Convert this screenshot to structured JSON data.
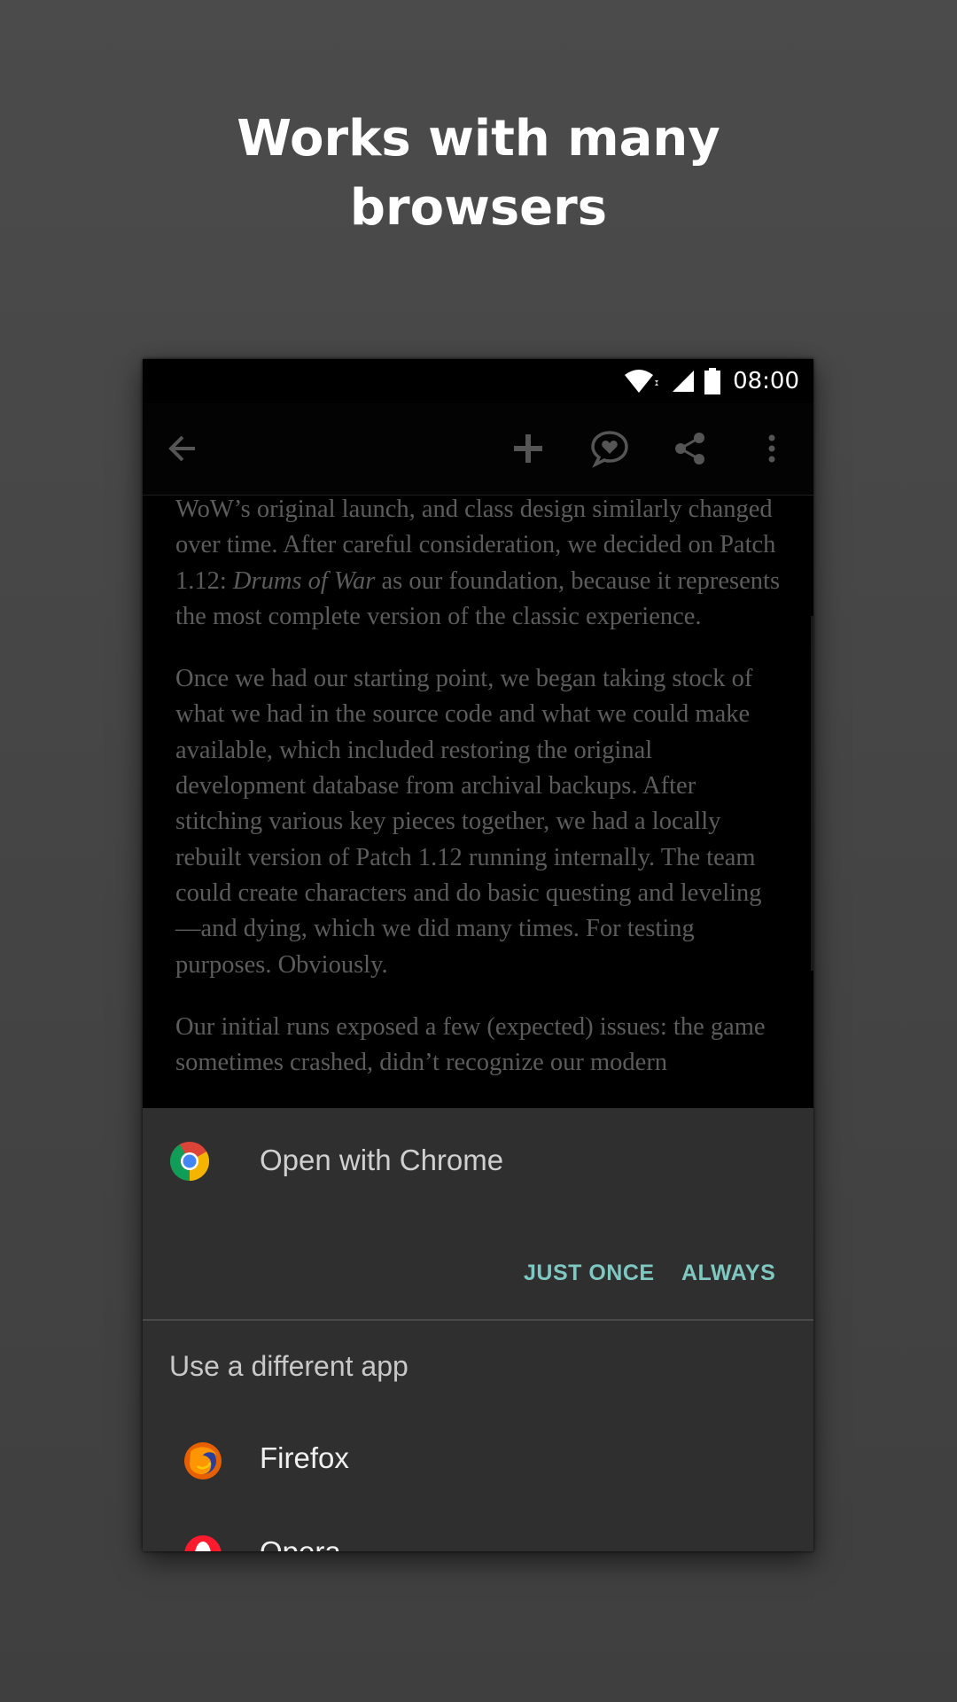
{
  "headline": [
    "Works with many",
    "browsers"
  ],
  "status_bar": {
    "time": "08:00"
  },
  "toolbar": {
    "icons": [
      "back-arrow-icon",
      "add-icon",
      "comment-heart-icon",
      "share-icon",
      "more-vert-icon"
    ]
  },
  "article": {
    "paragraphs": [
      [
        "WoW’s original launch, and class design similarly changed over time. After careful consideration, we decided on Patch 1.12: ",
        "Drums of War",
        " as our foundation, because it represents the most complete version of the classic experience."
      ],
      "Once we had our starting point, we began taking stock of what we had in the source code and what we could make available, which included restoring the original development database from archival backups. After stitching various key pieces together, we had a locally rebuilt version of Patch 1.12 running internally. The team could create characters and do basic questing and leveling—and dying, which we did many times. For testing purposes. Obviously.",
      "Our initial runs exposed a few (expected) issues: the game sometimes crashed, didn’t recognize our modern"
    ]
  },
  "chooser": {
    "open_with": "Open with Chrome",
    "just_once": "JUST ONCE",
    "always": "ALWAYS",
    "different_app_title": "Use a different app",
    "apps": [
      {
        "name": "Firefox",
        "icon": "firefox-icon"
      },
      {
        "name": "Opera",
        "icon": "opera-icon"
      }
    ]
  },
  "colors": {
    "accent": "#7fc8c1",
    "sheet_bg": "#2f2f2f",
    "page_bg": "#474747"
  }
}
